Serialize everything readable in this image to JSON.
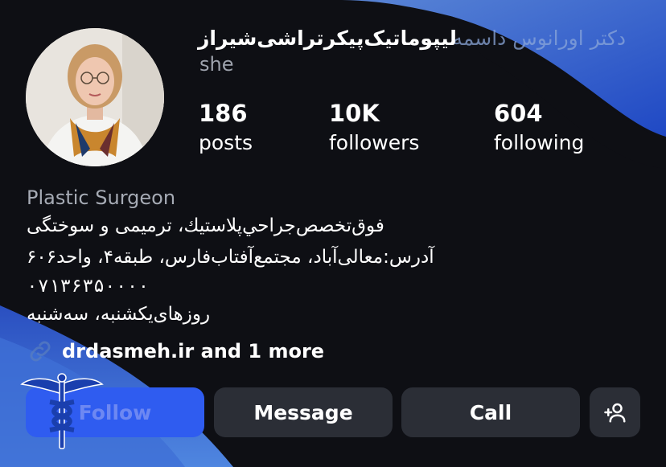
{
  "profile": {
    "name_main": "لیپوماتیک‌پیکرتراشی‌شیراز",
    "name_faded": "دکتر اورانوس داسمه",
    "pronoun": "she",
    "avatar_icon": "profile-photo"
  },
  "stats": {
    "posts": {
      "value": "186",
      "label": "posts"
    },
    "followers": {
      "value": "10K",
      "label": "followers"
    },
    "following": {
      "value": "604",
      "label": "following"
    }
  },
  "bio": {
    "category": "Plastic Surgeon",
    "line1": "فوق‌تخصص‌جراحي‌پلاستيك، ترمیمی و سوختگی",
    "line2": "آدرس:معالی‌آباد، مجتمع‌آفتاب‌فارس، طبقه۴، واحد۶۰۶",
    "line3": "۰۷۱۳۶۳۵۰۰۰۰",
    "line4": "روزهای‌یکشنبه، سه‌شنبه"
  },
  "link": {
    "text": "drdasmeh.ir and 1 more",
    "icon": "link-icon"
  },
  "actions": {
    "follow": "Follow",
    "message": "Message",
    "call": "Call",
    "add_user_icon": "add-person-icon"
  },
  "colors": {
    "background": "#0e0f14",
    "accent_blue": "#2f5cf0",
    "button_gray": "#2b2e36"
  }
}
